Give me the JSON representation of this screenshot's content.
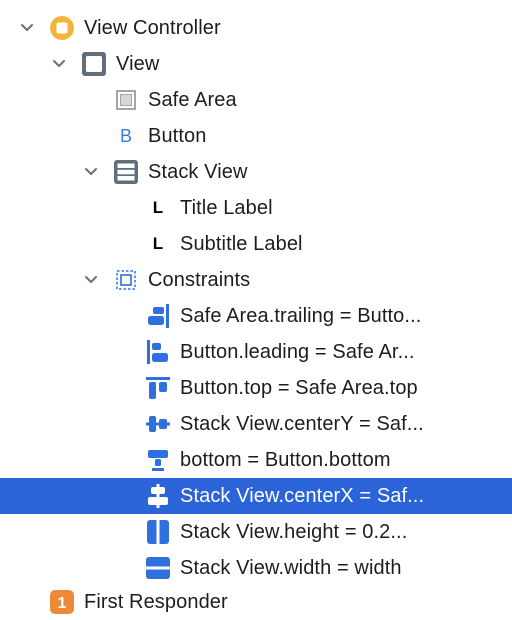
{
  "tree": {
    "view_controller": "View Controller",
    "view": "View",
    "safe_area": "Safe Area",
    "button": "Button",
    "stack_view": "Stack View",
    "title_label": "Title Label",
    "subtitle_label": "Subtitle Label",
    "constraints": "Constraints",
    "constraint_items": [
      "Safe Area.trailing = Butto...",
      "Button.leading = Safe Ar...",
      "Button.top = Safe Area.top",
      "Stack View.centerY = Saf...",
      "bottom = Button.bottom",
      "Stack View.centerX = Saf...",
      "Stack View.height = 0.2...",
      "Stack View.width = width"
    ],
    "first_responder": "First Responder",
    "button_icon_letter": "B",
    "label_icon_letter": "L",
    "first_responder_badge": "1"
  },
  "colors": {
    "selection": "#2b63d9",
    "constraint_icon": "#2f6fde",
    "view_controller_icon": "#f2b53a",
    "view_icon": "#5f6f7d",
    "first_responder_icon": "#ec8a3a"
  },
  "icons": {
    "disclosure": "chevron-down-icon",
    "view_controller": "view-controller-icon",
    "view": "view-icon",
    "safe_area": "safe-area-icon",
    "stack_view": "stack-view-icon",
    "constraints": "constraints-icon"
  }
}
